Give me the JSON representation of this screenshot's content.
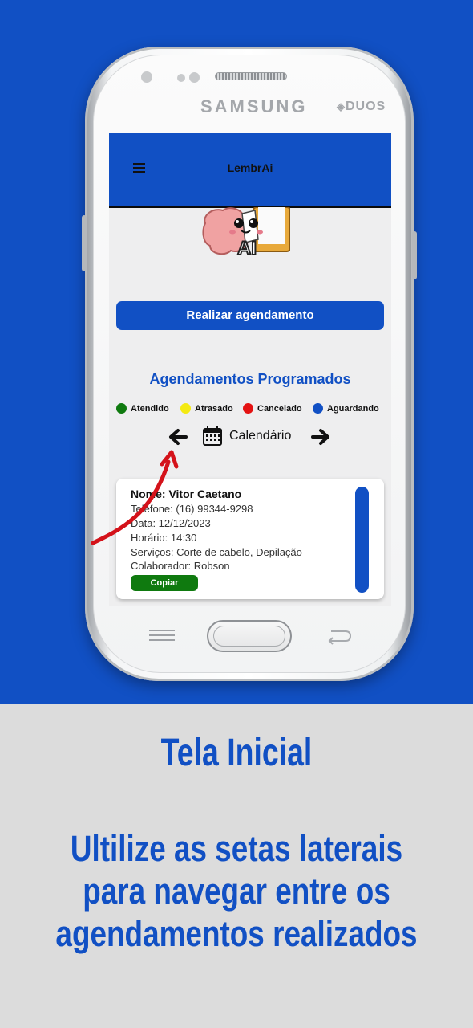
{
  "device": {
    "brand": "SAMSUNG",
    "model_badge": "DUOS"
  },
  "app": {
    "title": "LembrAi",
    "logo_text": "AI",
    "primary_button": "Realizar agendamento",
    "section_title": "Agendamentos Programados",
    "legend": [
      {
        "label": "Atendido",
        "color": "#0f7a0f"
      },
      {
        "label": "Atrasado",
        "color": "#f4ea12"
      },
      {
        "label": "Cancelado",
        "color": "#e41212"
      },
      {
        "label": "Aguardando",
        "color": "#1150c4"
      }
    ],
    "calendar_label": "Calendário",
    "card": {
      "name": "Nome: Vitor Caetano",
      "phone": "Telefone: (16) 99344-9298",
      "date": "Data: 12/12/2023",
      "time": "Horário: 14:30",
      "services": "Serviços: Corte de cabelo, Depilação",
      "collaborator": "Colaborador: Robson",
      "copy_button": "Copiar",
      "status_color": "#1150c4"
    }
  },
  "caption": {
    "title": "Tela Inicial",
    "body_lines": [
      "Ultilize as setas laterais",
      "para navegar entre os",
      "agendamentos realizados"
    ]
  },
  "colors": {
    "brand_blue": "#1150c4",
    "background_gray": "#dcdcdc",
    "annotation_red": "#d4121a"
  }
}
